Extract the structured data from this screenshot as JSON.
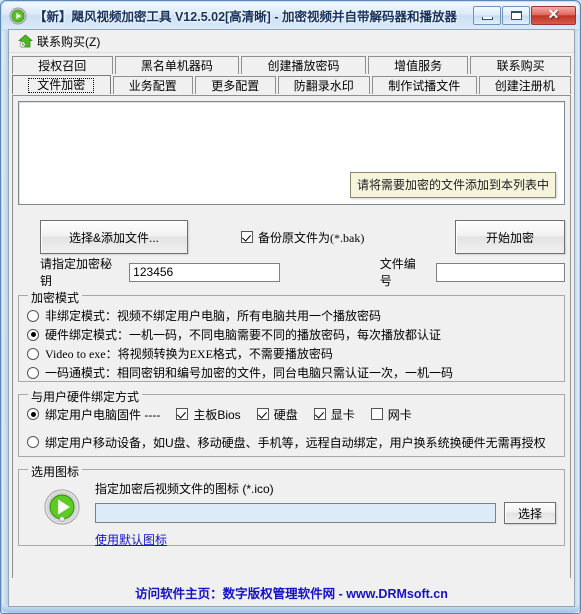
{
  "window": {
    "title": "【新】飓风视频加密工具 V12.5.02[高清晰] - 加密视频并自带解码器和播放器",
    "app_icon": "green-media-disc-icon",
    "controls": {
      "minimize": "minimize-icon",
      "maximize": "maximize-icon",
      "close": "✕"
    }
  },
  "menubar": {
    "items": [
      {
        "label": "联系购买(Z)",
        "icon": "green-house-icon"
      }
    ]
  },
  "tabs": {
    "row1": [
      {
        "label": "授权召回",
        "selected": false
      },
      {
        "label": "黑名单机器码",
        "selected": false
      },
      {
        "label": "创建播放密码",
        "selected": false
      },
      {
        "label": "增值服务",
        "selected": false
      },
      {
        "label": "联系购买",
        "selected": false
      }
    ],
    "row2": [
      {
        "label": "文件加密",
        "selected": true
      },
      {
        "label": "业务配置",
        "selected": false
      },
      {
        "label": "更多配置",
        "selected": false
      },
      {
        "label": "防翻录水印",
        "selected": false
      },
      {
        "label": "制作试播文件",
        "selected": false
      },
      {
        "label": "创建注册机",
        "selected": false
      }
    ]
  },
  "filelist": {
    "items": [],
    "tooltip": "请将需要加密的文件添加到本列表中"
  },
  "actions": {
    "add_files_label": "选择&添加文件...",
    "backup_checkbox": {
      "label_cn": "备份原文件为",
      "label_ext": "(*.bak)",
      "checked": true
    },
    "start_label": "开始加密"
  },
  "key_row": {
    "key_label": "请指定加密秘钥",
    "key_value": "123456",
    "file_no_label": "文件编号",
    "file_no_value": ""
  },
  "encrypt_mode": {
    "title": "加密模式",
    "options": [
      {
        "label": "非绑定模式：视频不绑定用户电脑，所有电脑共用一个播放密码",
        "selected": false,
        "ascii": false
      },
      {
        "label": "硬件绑定模式：一机一码，不同电脑需要不同的播放密码，每次播放都认证",
        "selected": true,
        "ascii": false
      },
      {
        "label": "Video to exe：将视频转换为EXE格式，不需要播放密码",
        "selected": false,
        "ascii": true
      },
      {
        "label": "一码通模式：相同密钥和编号加密的文件，同台电脑只需认证一次，一机一码",
        "selected": false,
        "ascii": false
      }
    ]
  },
  "hardware_bind": {
    "title": "与用户硬件绑定方式",
    "option1": {
      "label": "绑定用户电脑固件 ----",
      "selected": true,
      "checkboxes": [
        {
          "label": "主板Bios",
          "checked": true
        },
        {
          "label": "硬盘",
          "checked": true
        },
        {
          "label": "显卡",
          "checked": true
        },
        {
          "label": "网卡",
          "checked": false
        }
      ]
    },
    "option2": {
      "label": "绑定用户移动设备，如U盘、移动硬盘、手机等，远程自动绑定，用户换系统换硬件无需再授权",
      "selected": false
    }
  },
  "icon_group": {
    "title": "选用图标",
    "preview_icon": "green-play-disc-icon",
    "caption": "指定加密后视频文件的图标 (*.ico)",
    "path_value": "",
    "select_label": "选择",
    "default_link": "使用默认图标"
  },
  "footer": {
    "text": "访问软件主页：数字版权管理软件网 - www.DRMsoft.cn"
  },
  "colors": {
    "titlebar_text": "#16325c",
    "footer_text": "#1313c4",
    "link": "#1414cc",
    "tooltip_bg": "#f7f4dc",
    "accent_green": "#4cb81f",
    "close_button": "#c03427"
  }
}
